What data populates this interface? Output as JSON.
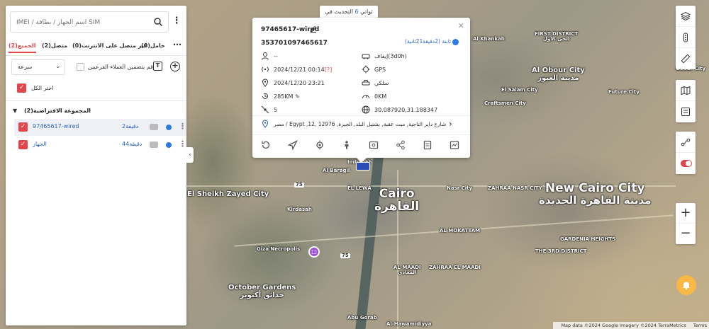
{
  "search": {
    "placeholder": "IMEI / اسم الجهاز / بطاقة SIM"
  },
  "tabs": [
    {
      "label": "الجميع(2)"
    },
    {
      "label": "متصل(2)"
    },
    {
      "label": "غير متصل على الانترنت(0)"
    },
    {
      "label": "خامل(0)"
    }
  ],
  "toolbar": {
    "sort_label": "سرعة",
    "check_customers_label": "قم بتضمين العملاء الفرعيين"
  },
  "select_all_label": "اختر الكل",
  "group": {
    "label": "المجموعة الافتراضية(2)"
  },
  "devices": [
    {
      "name": "97465617-wired",
      "time": "2دقيقة"
    },
    {
      "name": "الجهاز",
      "time": "44دقيقة"
    }
  ],
  "banner": {
    "count": "6",
    "pre": "ثواني",
    "post": "التحديث في"
  },
  "popup": {
    "title": "97465617-wired",
    "imei": "353701097465617",
    "status": "ثابتة (2دقيقة21ثانية)",
    "user": "--",
    "stop_duration": "إيقاف(3d0h)",
    "signal_time": "2024/12/21 00:14",
    "signal_flag": "[?]",
    "positioning": "GPS",
    "location_time": "2024/12/20 23:21",
    "connection": "سلكي",
    "mileage": "285KM",
    "today_mileage": "0KM",
    "satellites": "5",
    "coords": "30.087920,31.188347",
    "address": "مصر / Egypt ,شارع داير الناحية, ميت عقبة, بشتيل البلد, الجيزة, 12976 ,12"
  },
  "map_labels": {
    "cairo_en": "Cairo",
    "cairo_ar": "القاهرة",
    "new_cairo_en": "New Cairo City",
    "new_cairo_ar": "مدينة القاهرة الجديدة",
    "obour_en": "Al Obour City",
    "obour_ar": "مدينة العبور",
    "first_district": "FIRST DISTRICT",
    "first_district_ar": "الحي الأول",
    "sheikh_zayed": "El Sheikh Zayed City",
    "october": "October Gardens",
    "october_ar": "حدائق أكتوبر",
    "giza_necropolis": "Giza Necropolis",
    "maadi": "AL MAADI",
    "maadi_ar": "المعادي",
    "hawamdiya": "Al-Hawamidiyya",
    "kirdasah": "Kirdasah",
    "future_city": "Future City",
    "craftsmen": "Craftsmen City",
    "el_salam": "El Salam City",
    "nasr_city": "Nasr City",
    "third_district": "THE 3RD DISTRICT",
    "gardenia": "GARDENIA HEIGHTS",
    "obour_right": "Obour City",
    "al_khankah": "Al Khankah",
    "al_baragil": "Al Baragil",
    "imbabah": "Imbabah",
    "el_lewa": "EL LEWA",
    "mokattam": "AL MOKATTAM",
    "zahraa_nasr": "ZAHRAA NASR CITY",
    "zahraa_maadi": "ZAHRAA EL MAADI",
    "abu_gorab": "Abu Gorab",
    "road_75": "75"
  },
  "attribution": {
    "data": "Map data ©2024 Google Imagery ©2024 TerraMetrics",
    "terms": "Terms"
  }
}
